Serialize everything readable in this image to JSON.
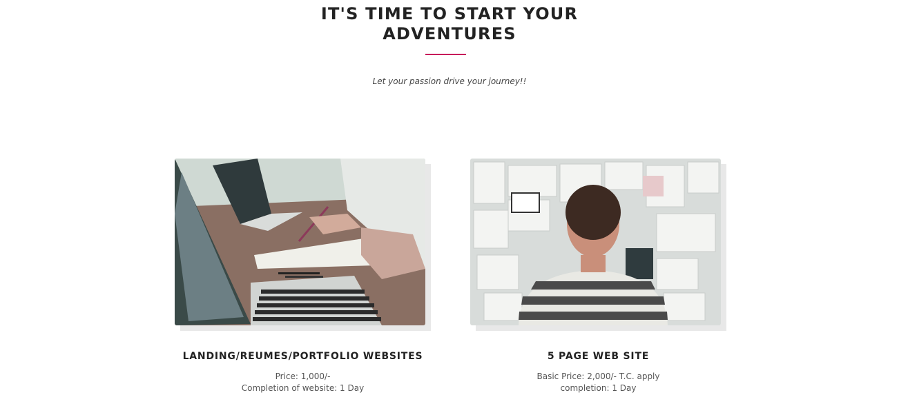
{
  "section": {
    "title_line1": "IT'S TIME TO START YOUR",
    "title_line2": "ADVENTURES",
    "subtitle": "Let your passion drive your journey!!",
    "accent_color": "#c7185a"
  },
  "services": [
    {
      "name": "LANDING/REUMES/PORTFOLIO WEBSITES",
      "line1": "Price: 1,000/-",
      "line2": "Completion of website: 1 Day",
      "image": "laptops-and-notes-photo"
    },
    {
      "name": "5 PAGE WEB SITE",
      "line1": "Basic Price: 2,000/- T.C. apply",
      "line2": "completion: 1 Day",
      "image": "man-looking-at-mood-board-photo"
    }
  ]
}
